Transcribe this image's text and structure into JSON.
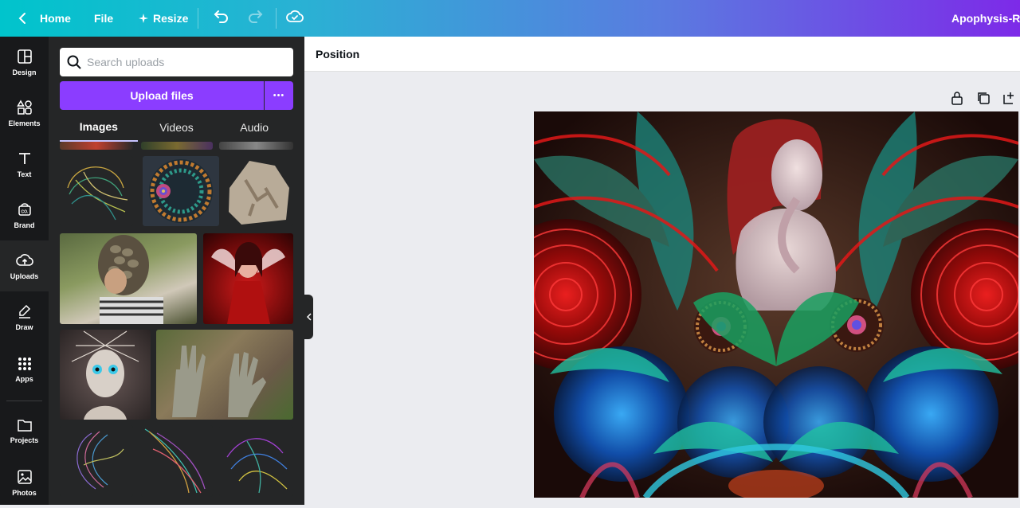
{
  "topbar": {
    "home": "Home",
    "file": "File",
    "resize": "Resize",
    "doc_title": "Apophysis-Re"
  },
  "rail": [
    {
      "label": "Design",
      "icon": "design-icon"
    },
    {
      "label": "Elements",
      "icon": "elements-icon"
    },
    {
      "label": "Text",
      "icon": "text-icon"
    },
    {
      "label": "Brand",
      "icon": "brand-icon"
    },
    {
      "label": "Uploads",
      "icon": "uploads-icon"
    },
    {
      "label": "Draw",
      "icon": "draw-icon"
    },
    {
      "label": "Apps",
      "icon": "apps-icon"
    },
    {
      "label": "Projects",
      "icon": "projects-icon"
    },
    {
      "label": "Photos",
      "icon": "photos-icon"
    }
  ],
  "panel": {
    "search_placeholder": "Search uploads",
    "upload_label": "Upload files",
    "more_label": "•••",
    "tabs": [
      "Images",
      "Videos",
      "Audio"
    ],
    "active_tab": "Images"
  },
  "toolbar": {
    "position_label": "Position"
  },
  "colors": {
    "brand_purple": "#8b3dff",
    "topbar_start": "#00c4cc",
    "topbar_end": "#7d2ae8",
    "rail_bg": "#18191b",
    "panel_bg": "#252627"
  }
}
